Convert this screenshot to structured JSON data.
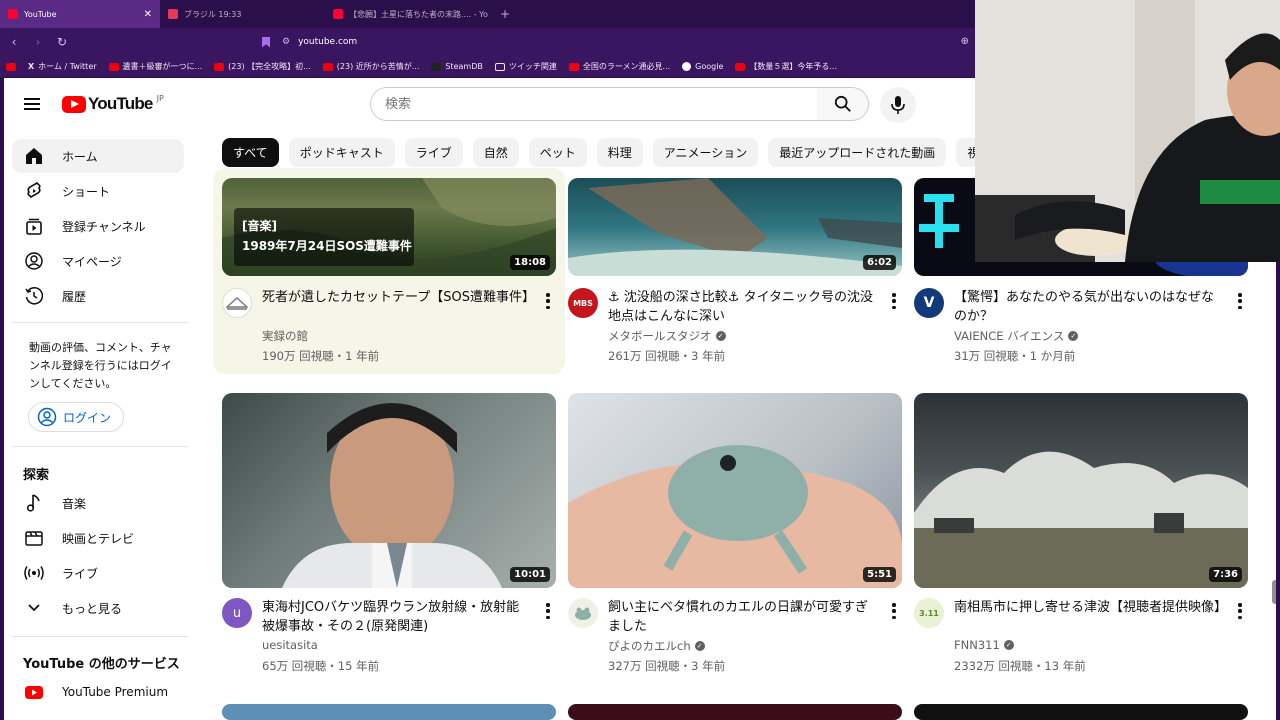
{
  "browser": {
    "tabs": [
      {
        "label": "YouTube",
        "color": "#ff0033"
      },
      {
        "label": "ブラジル 19:33",
        "color": "#e5395b"
      },
      {
        "label": "【悲願】土星に落ちた者の末路.... - Yo",
        "color": "#ff0033"
      }
    ],
    "url": "youtube.com",
    "bookmarks": [
      {
        "label": "ホーム / Twitter",
        "icon": "x-icon"
      },
      {
        "label": "遺書＋級審が一つに...",
        "icon": "red"
      },
      {
        "label": "(23) 【完全攻略】初...",
        "icon": "red"
      },
      {
        "label": "(23) 近所から苦情が...",
        "icon": "red"
      },
      {
        "label": "SteamDB",
        "icon": "dark"
      },
      {
        "label": "ツイッチ関連",
        "icon": "folder"
      },
      {
        "label": "全国のラーメン通必見...",
        "icon": "red"
      },
      {
        "label": "Google",
        "icon": "google"
      },
      {
        "label": "【数量５選】今年予る...",
        "icon": "red"
      }
    ]
  },
  "header": {
    "logo_text": "YouTube",
    "logo_region": "JP",
    "search_placeholder": "検索"
  },
  "chips": [
    "すべて",
    "ポッドキャスト",
    "ライブ",
    "自然",
    "ペット",
    "料理",
    "アニメーション",
    "最近アップロードされた動画",
    "視聴済み"
  ],
  "sidebar": {
    "nav": [
      {
        "label": "ホーム",
        "icon": "home-icon"
      },
      {
        "label": "ショート",
        "icon": "shorts-icon"
      },
      {
        "label": "登録チャンネル",
        "icon": "subscriptions-icon"
      },
      {
        "label": "マイページ",
        "icon": "profile-icon"
      },
      {
        "label": "履歴",
        "icon": "history-icon"
      }
    ],
    "login_note": "動画の評価、コメント、チャンネル登録を行うにはログインしてください。",
    "login_label": "ログイン",
    "explore_heading": "探索",
    "explore": [
      {
        "label": "音楽",
        "icon": "music-icon"
      },
      {
        "label": "映画とテレビ",
        "icon": "film-icon"
      },
      {
        "label": "ライブ",
        "icon": "live-icon"
      },
      {
        "label": "もっと見る",
        "icon": "chevron-down-icon"
      }
    ],
    "other_heading": "YouTube の他のサービス",
    "premium_label": "YouTube Premium"
  },
  "videos": [
    {
      "title": "死者が遺したカセットテープ【SOS遭難事件】",
      "channel": "実録の館",
      "verified": false,
      "meta": "190万 回視聴・1 年前",
      "duration": "18:08",
      "thumb_text": "[音楽]\n1989年7月24日SOS遭難事件",
      "avatar_text": ""
    },
    {
      "title": "⚓ 沈没船の深さ比較⚓ タイタニック号の沈没地点はこんなに深い",
      "channel": "メタボールスタジオ",
      "verified": true,
      "meta": "261万 回視聴・3 年前",
      "duration": "6:02",
      "avatar_text": "MBS"
    },
    {
      "title": "【驚愕】あなたのやる気が出ないのはなぜなのか？",
      "channel": "VAIENCE バイエンス",
      "verified": true,
      "meta": "31万 回視聴・1 か月前",
      "duration": "",
      "avatar_text": "V"
    },
    {
      "title": "東海村JCOバケツ臨界ウラン放射線・放射能被爆事故・その２(原発関連)",
      "channel": "uesitasita",
      "verified": false,
      "meta": "65万 回視聴・15 年前",
      "duration": "10:01",
      "avatar_text": "u"
    },
    {
      "title": "飼い主にベタ慣れのカエルの日課が可愛すぎました",
      "channel": "ぴよのカエルch",
      "verified": true,
      "meta": "327万 回視聴・3 年前",
      "duration": "5:51",
      "avatar_text": ""
    },
    {
      "title": "南相馬市に押し寄せる津波【視聴者提供映像】",
      "channel": "FNN311",
      "verified": true,
      "meta": "2332万 回視聴・13 年前",
      "duration": "7:36",
      "avatar_text": "3.11"
    }
  ]
}
